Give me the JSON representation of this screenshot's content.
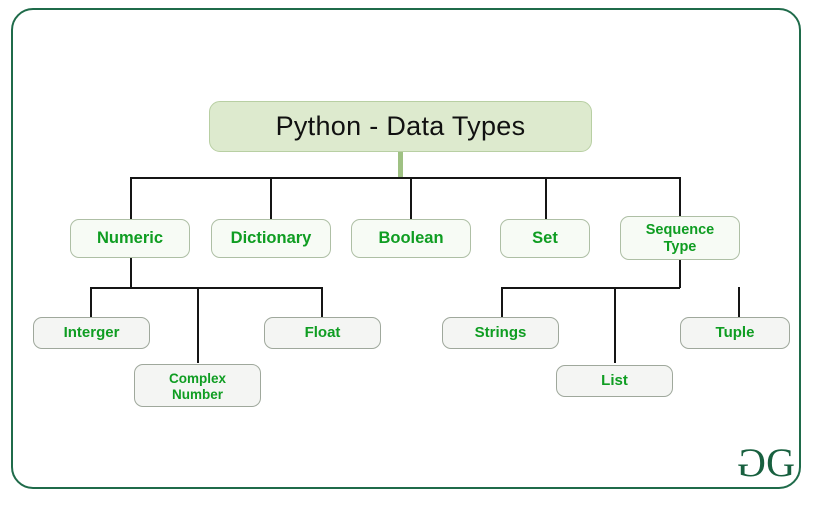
{
  "diagram": {
    "title": "Python - Data Types",
    "logo": {
      "left_glyph": "G",
      "right_glyph": "G",
      "name": "geeksforgeeks-logo"
    },
    "colors": {
      "frame_border": "#1f6b4a",
      "title_fill": "#ddeace",
      "title_border": "#b8cfa3",
      "node_fill": "#f7fbf5",
      "leaf_fill": "#f4f5f3",
      "node_text": "#0f9d22",
      "title_text": "#111111",
      "connector": "#151515",
      "connector_green": "#9fc183",
      "logo": "#18603f"
    },
    "level2": [
      {
        "id": "numeric",
        "label": "Numeric"
      },
      {
        "id": "dictionary",
        "label": "Dictionary"
      },
      {
        "id": "boolean",
        "label": "Boolean"
      },
      {
        "id": "set",
        "label": "Set"
      },
      {
        "id": "sequence-type",
        "label_line1": "Sequence",
        "label_line2": "Type"
      }
    ],
    "numeric_children": [
      {
        "id": "interger",
        "label": "Interger"
      },
      {
        "id": "complex-number",
        "label_line1": "Complex",
        "label_line2": "Number"
      },
      {
        "id": "float",
        "label": "Float"
      }
    ],
    "sequence_children": [
      {
        "id": "strings",
        "label": "Strings"
      },
      {
        "id": "list",
        "label": "List"
      },
      {
        "id": "tuple",
        "label": "Tuple"
      }
    ]
  }
}
